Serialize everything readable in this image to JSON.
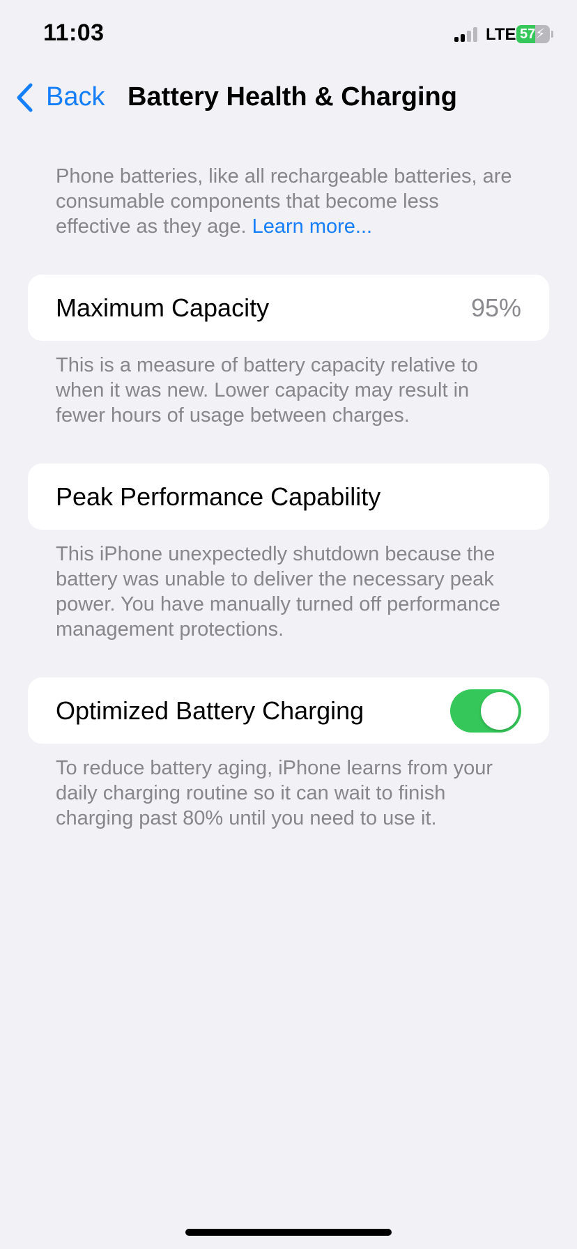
{
  "status_bar": {
    "time": "11:03",
    "network": "LTE",
    "battery_percent": "57",
    "battery_level": 0.57,
    "signal_bars_on": 2,
    "signal_bars_total": 4
  },
  "nav": {
    "back_label": "Back",
    "title": "Battery Health & Charging"
  },
  "intro": {
    "text": "Phone batteries, like all rechargeable batteries, are consumable components that become less effective as they age. ",
    "link": "Learn more..."
  },
  "max_capacity": {
    "label": "Maximum Capacity",
    "value": "95%",
    "footnote": "This is a measure of battery capacity relative to when it was new. Lower capacity may result in fewer hours of usage between charges."
  },
  "peak_performance": {
    "label": "Peak Performance Capability",
    "footnote": "This iPhone unexpectedly shutdown because the battery was unable to deliver the necessary peak power. You have manually turned off performance management protections."
  },
  "optimized_charging": {
    "label": "Optimized Battery Charging",
    "enabled": true,
    "footnote": "To reduce battery aging, iPhone learns from your daily charging routine so it can wait to finish charging past 80% until you need to use it."
  },
  "colors": {
    "accent": "#157efb",
    "toggle_on": "#35c759",
    "background": "#f1f1f6",
    "secondary_text": "#86868b"
  },
  "icons": {
    "back": "chevron-left-icon",
    "signal": "cellular-signal-icon",
    "battery": "battery-charging-icon"
  }
}
